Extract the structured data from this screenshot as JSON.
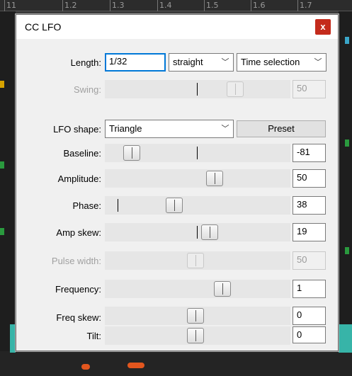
{
  "background": {
    "ruler_ticks": [
      "11",
      "1.2",
      "1.3",
      "1.4",
      "1.5",
      "1.6",
      "1.7"
    ]
  },
  "dialog": {
    "title": "CC LFO",
    "close_label": "x",
    "length": {
      "label": "Length:",
      "value": "1/32",
      "mode": "straight",
      "range": "Time selection"
    },
    "swing": {
      "label": "Swing:",
      "value": "50",
      "disabled": true,
      "level": 0.63
    },
    "lfo_shape": {
      "label": "LFO shape:",
      "value": "Triangle",
      "preset_label": "Preset"
    },
    "sliders": [
      {
        "key": "baseline",
        "label": "Baseline:",
        "value": "-81",
        "level": 0.1
      },
      {
        "key": "amplitude",
        "label": "Amplitude:",
        "value": "50",
        "level": 0.6
      },
      {
        "key": "phase",
        "label": "Phase:",
        "value": "38",
        "level": 0.35
      },
      {
        "key": "amp-skew",
        "label": "Amp skew:",
        "value": "19",
        "level": 0.55
      },
      {
        "key": "pulse-width",
        "label": "Pulse width:",
        "value": "50",
        "level": 0.5,
        "disabled": true
      },
      {
        "key": "frequency",
        "label": "Frequency:",
        "value": "1",
        "level": 0.62
      },
      {
        "key": "freq-skew",
        "label": "Freq skew:",
        "value": "0",
        "level": 0.5
      },
      {
        "key": "tilt",
        "label": "Tilt:",
        "value": "0",
        "level": 0.5
      }
    ]
  }
}
